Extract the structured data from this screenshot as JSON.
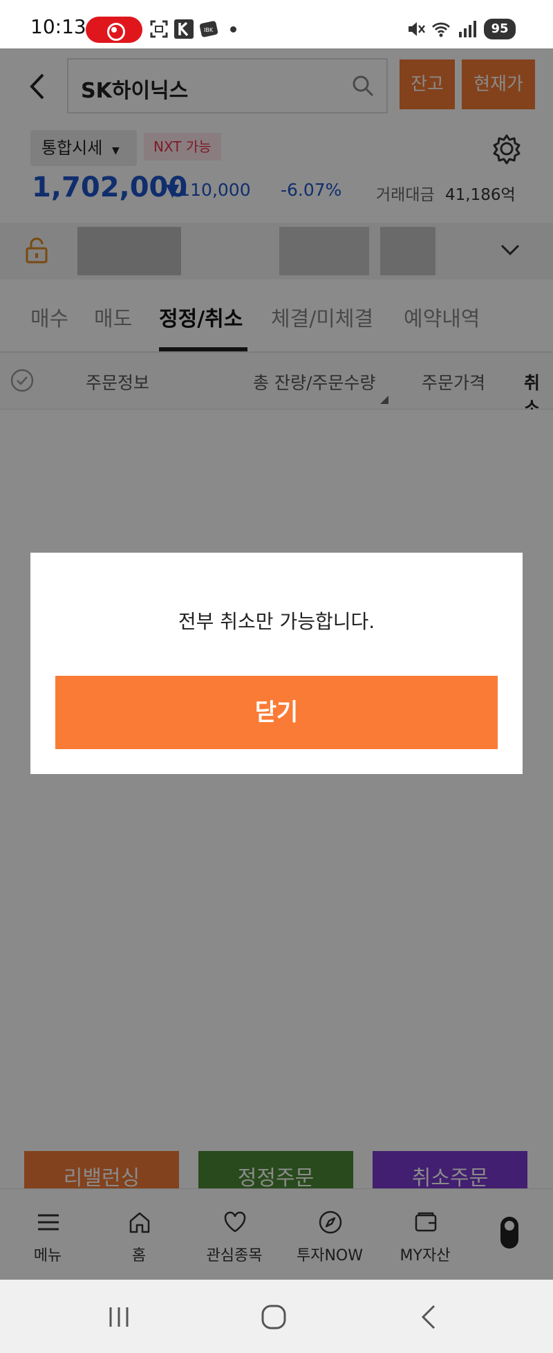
{
  "status_bar": {
    "time": "10:13",
    "battery": "95"
  },
  "header": {
    "search_text": "SK하이닉스",
    "btn_balance": "잔고",
    "btn_price": "현재가"
  },
  "quote": {
    "select_label": "통합시세",
    "nxt_badge": "NXT 가능",
    "price": "1,702,000",
    "change": "▼110,000",
    "change_pct": "-6.07%",
    "volume_label": "거래대금",
    "volume_value": "41,186억",
    "down_color": "#1f55c9"
  },
  "tabs": [
    {
      "label": "매수"
    },
    {
      "label": "매도"
    },
    {
      "label": "정정/취소"
    },
    {
      "label": "체결/미체결"
    },
    {
      "label": "예약내역"
    }
  ],
  "list_header": {
    "col_info": "주문정보",
    "col_qty": "총 잔량/주문수량",
    "col_price": "주문가격",
    "col_cancel": "취소"
  },
  "actions": [
    {
      "label": "리밸런싱",
      "color": "#c85a20"
    },
    {
      "label": "정정주문",
      "color": "#2f5a1b"
    },
    {
      "label": "취소주문",
      "color": "#4a1f88"
    }
  ],
  "bottom_nav": [
    {
      "label": "메뉴",
      "icon": "menu-icon"
    },
    {
      "label": "홈",
      "icon": "home-icon"
    },
    {
      "label": "관심종목",
      "icon": "heart-icon"
    },
    {
      "label": "투자NOW",
      "icon": "compass-icon"
    },
    {
      "label": "MY자산",
      "icon": "wallet-icon"
    }
  ],
  "modal": {
    "message": "전부 취소만 가능합니다.",
    "button": "닫기",
    "accent": "#fa7b36"
  }
}
